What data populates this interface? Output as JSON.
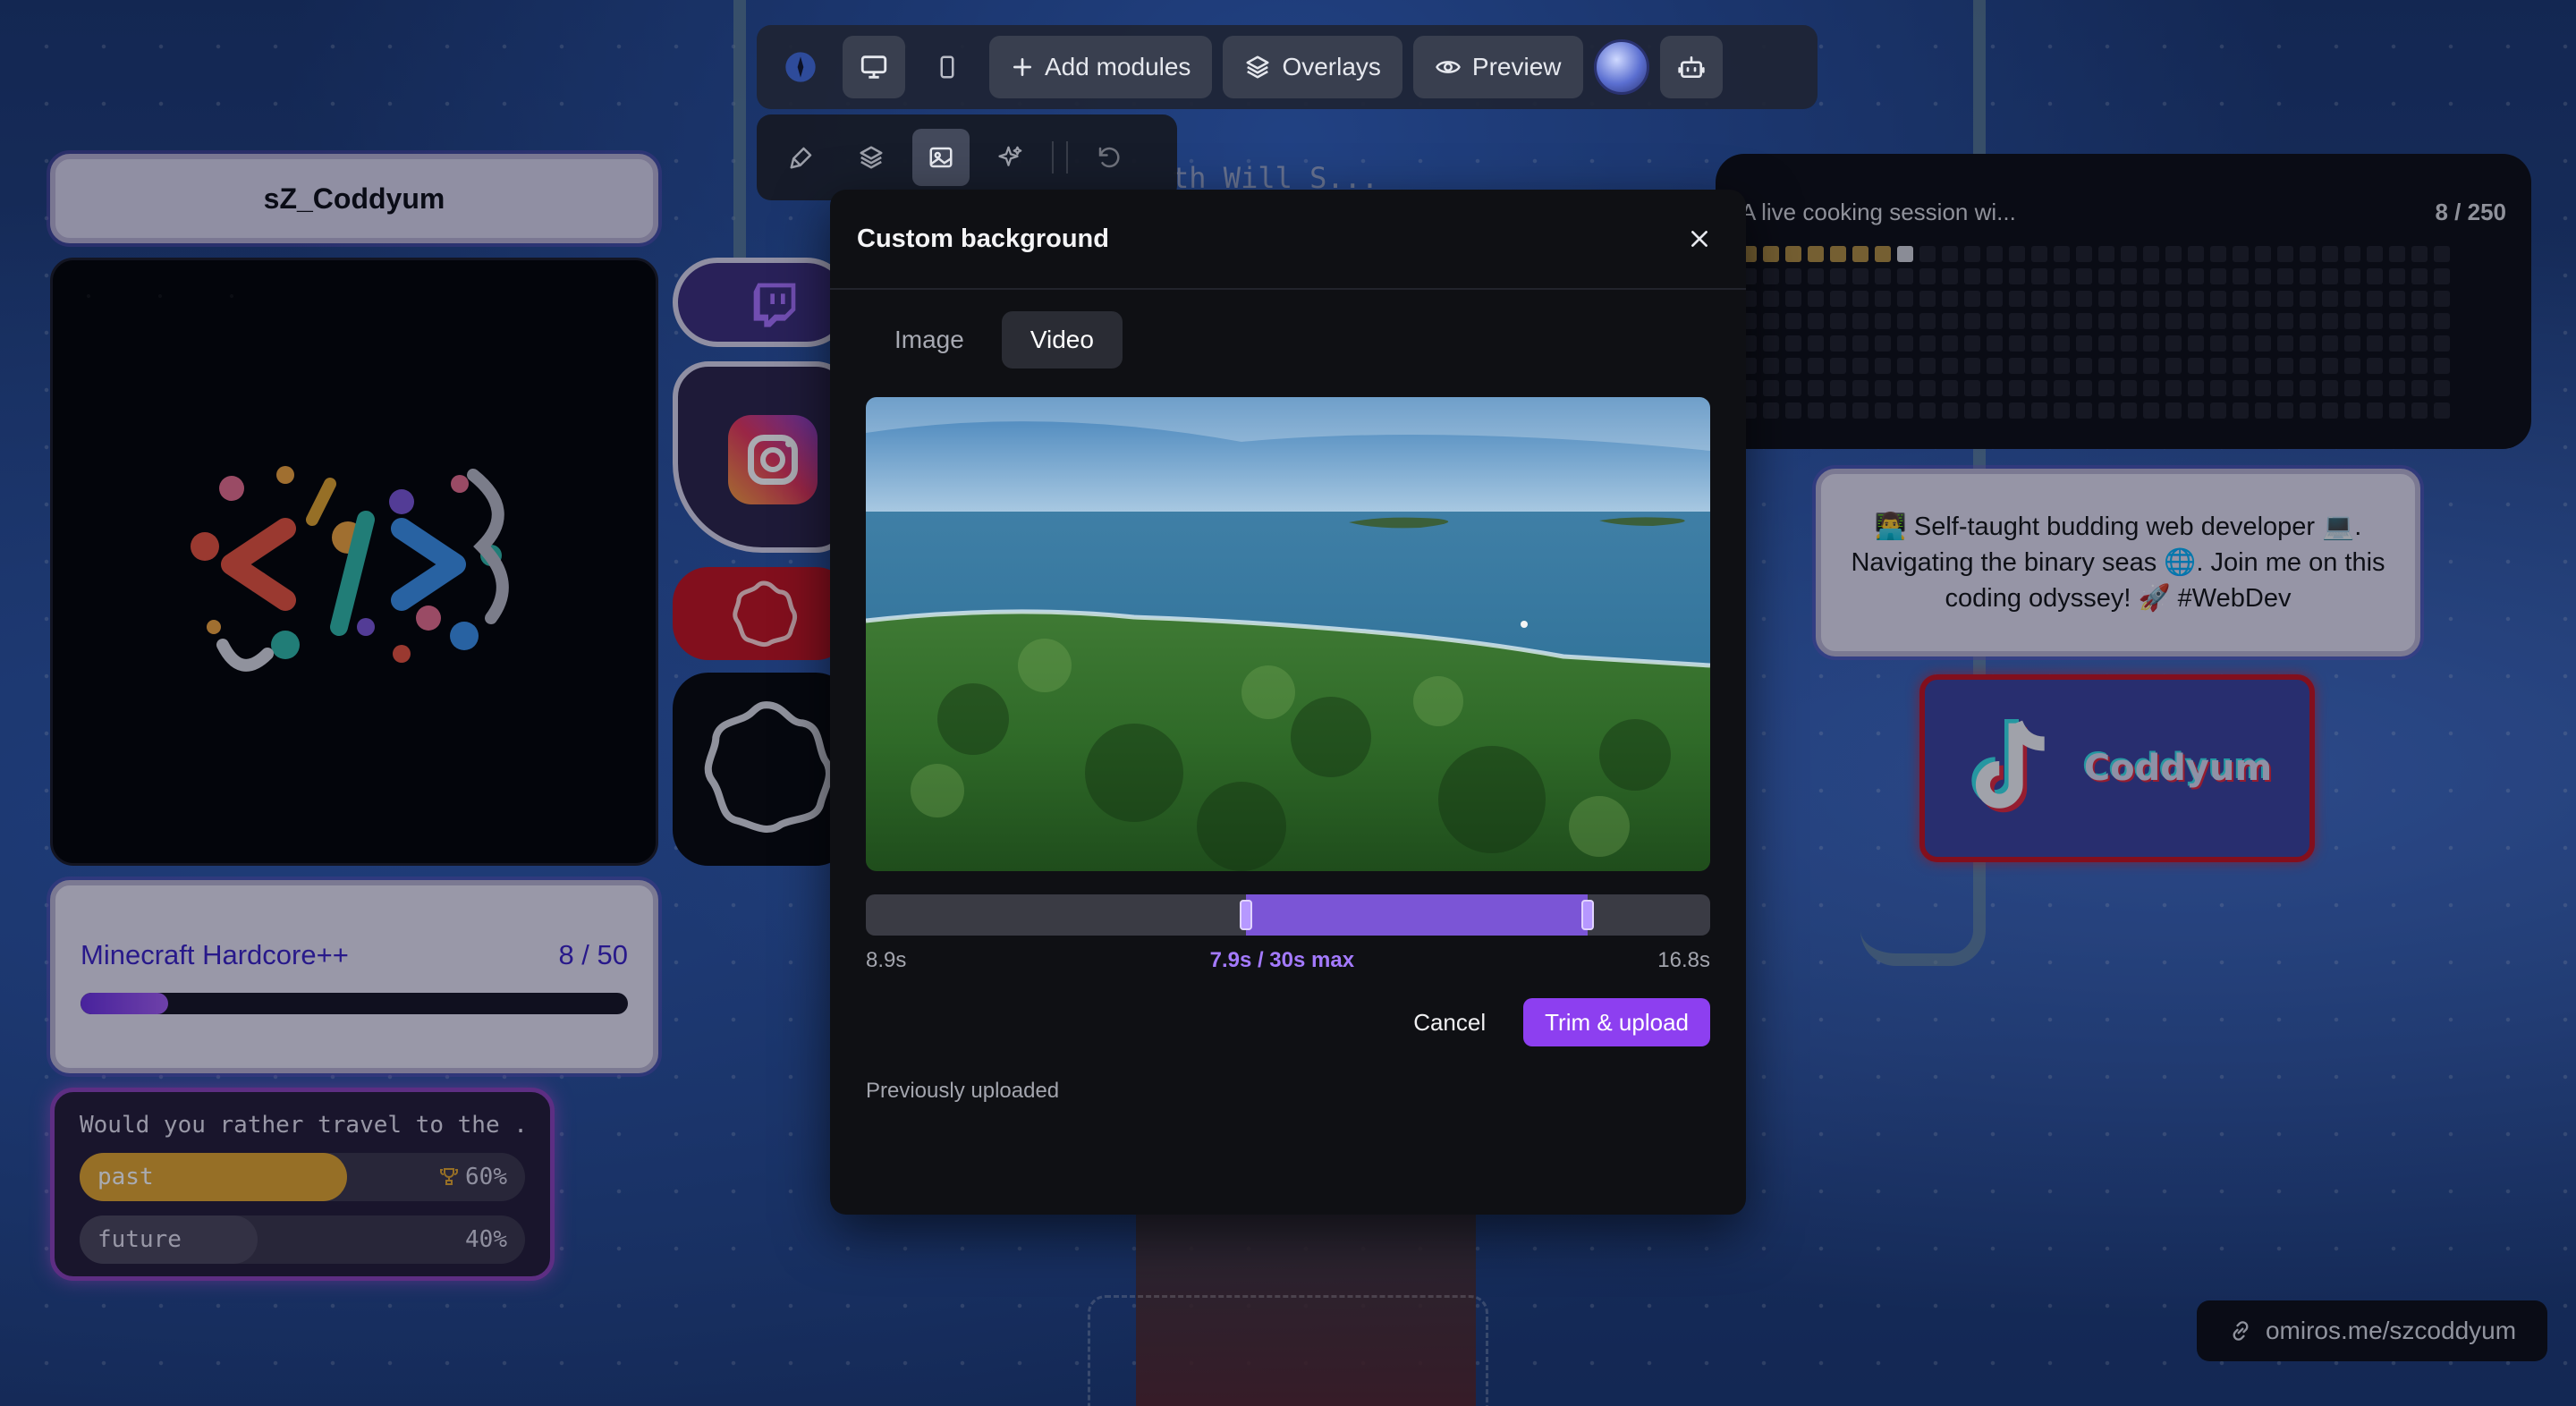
{
  "toolbar": {
    "add_modules_label": "Add modules",
    "overlays_label": "Overlays",
    "preview_label": "Preview"
  },
  "profile": {
    "username": "sZ_Coddyum"
  },
  "goal": {
    "title": "Minecraft Hardcore++",
    "count": "8 / 50",
    "progress": 0.16
  },
  "poll": {
    "question": "Would you rather travel to the ...",
    "options": [
      {
        "label": "past",
        "percent": "60%",
        "fraction": 0.6,
        "winner": true
      },
      {
        "label": "future",
        "percent": "40%",
        "fraction": 0.4,
        "winner": false
      }
    ]
  },
  "contributions": {
    "title": "A live cooking session wi...",
    "count": "8 / 250",
    "filled": 8,
    "total": 256
  },
  "bio": {
    "text": "👨‍💻 Self-taught budding web developer 💻. Navigating the binary seas 🌐. Join me on this coding odyssey! 🚀 #WebDev"
  },
  "tiktok": {
    "name": "Coddyum"
  },
  "link": {
    "url": "omiros.me/szcoddyum"
  },
  "background_text": "th Will S...",
  "modal": {
    "title": "Custom background",
    "tabs": [
      "Image",
      "Video"
    ],
    "active_tab": "Video",
    "trim": {
      "start_label": "8.9s",
      "duration_label": "7.9s / 30s max",
      "end_label": "16.8s",
      "range_start": 0.45,
      "range_end": 0.855
    },
    "cancel_label": "Cancel",
    "primary_label": "Trim & upload",
    "previously_uploaded_label": "Previously uploaded"
  },
  "colors": {
    "accent": "#8d3ff0",
    "poll_winner": "#e2a32a",
    "tiktok_border": "#c3101c"
  }
}
